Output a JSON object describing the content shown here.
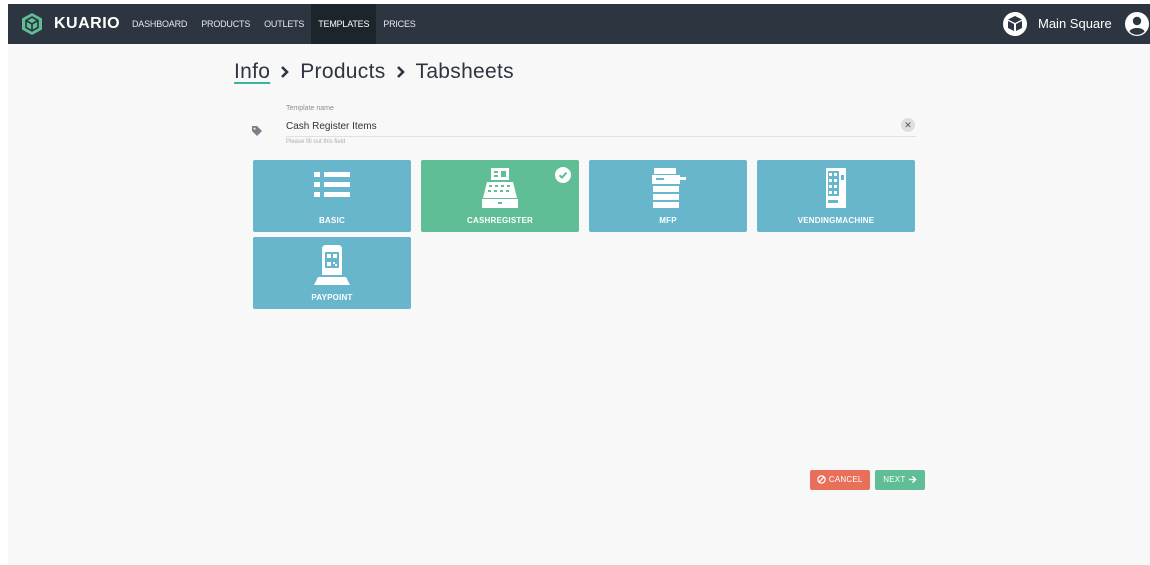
{
  "brand": {
    "name": "KUARIO"
  },
  "nav": {
    "items": [
      {
        "label": "DASHBOARD"
      },
      {
        "label": "PRODUCTS"
      },
      {
        "label": "OUTLETS"
      },
      {
        "label": "TEMPLATES"
      },
      {
        "label": "PRICES"
      }
    ],
    "active": "TEMPLATES"
  },
  "header": {
    "location": "Main Square"
  },
  "breadcrumb": {
    "items": [
      "Info",
      "Products",
      "Tabsheets"
    ]
  },
  "template_form": {
    "label": "Template name",
    "value": "Cash Register Items",
    "hint": "Please fill out this field",
    "clear_symbol": "✕"
  },
  "tiles": [
    {
      "label": "BASIC",
      "icon": "list-icon",
      "selected": false
    },
    {
      "label": "CASHREGISTER",
      "icon": "cash-register-icon",
      "selected": true
    },
    {
      "label": "MFP",
      "icon": "printer-icon",
      "selected": false
    },
    {
      "label": "VENDINGMACHINE",
      "icon": "vending-machine-icon",
      "selected": false
    },
    {
      "label": "PAYPOINT",
      "icon": "paypoint-stand-icon",
      "selected": false
    }
  ],
  "actions": {
    "cancel": "CANCEL",
    "next": "NEXT"
  },
  "colors": {
    "topbar": "#2c3540",
    "tile": "#67b6cc",
    "tile_selected": "#5fbe96",
    "cancel": "#e8705a",
    "next": "#5fbe96",
    "accent": "#3ab59d"
  }
}
